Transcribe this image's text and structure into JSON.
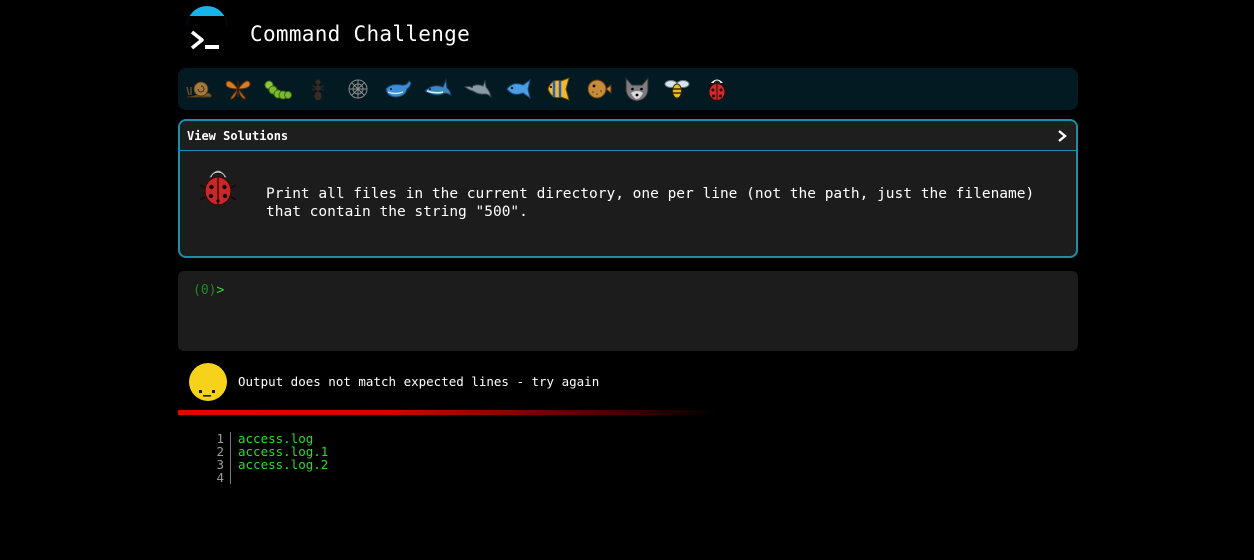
{
  "header": {
    "title": "Command Challenge"
  },
  "icon_bar": {
    "icons": [
      "snail-icon",
      "butterfly-icon",
      "caterpillar-icon",
      "ant-icon",
      "spiderweb-icon",
      "whale-icon",
      "shark-icon",
      "dolphin-icon",
      "fish-icon",
      "tropical-fish-icon",
      "blowfish-icon",
      "wolf-icon",
      "bee-icon",
      "ladybug-icon"
    ]
  },
  "challenge": {
    "solutions_label": "View Solutions",
    "text": "Print all files in the current directory, one per line (not the path, just the filename)\nthat contain the string \"500\".",
    "icon": "ladybug-icon"
  },
  "terminal": {
    "status": "(0)",
    "prompt_symbol": ">"
  },
  "result": {
    "message": "Output does not match expected lines - try again",
    "icon": "neutral-face-icon"
  },
  "output": {
    "lines": [
      {
        "number": "1",
        "text": "access.log"
      },
      {
        "number": "2",
        "text": "access.log.1"
      },
      {
        "number": "3",
        "text": "access.log.2"
      },
      {
        "number": "4",
        "text": ""
      }
    ]
  },
  "colors": {
    "accent": "#1b8fa8",
    "prompt_green": "#2bdc2b",
    "fail_red": "#e80000",
    "icon_bar_bg": "#031a22"
  }
}
